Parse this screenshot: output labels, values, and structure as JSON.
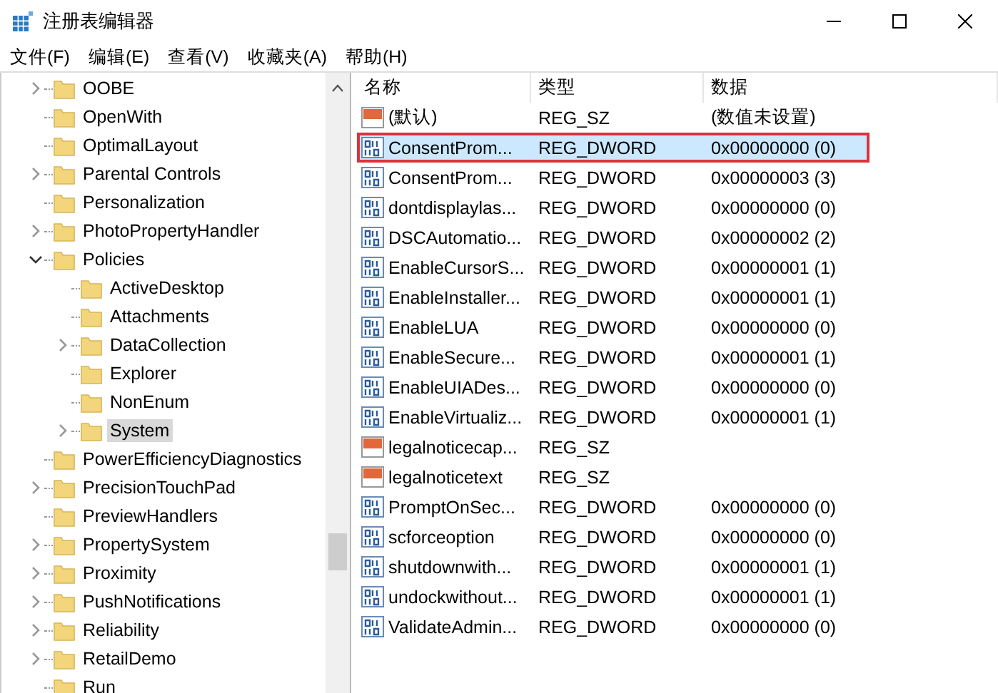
{
  "window": {
    "title": "注册表编辑器"
  },
  "menu": [
    "文件(F)",
    "编辑(E)",
    "查看(V)",
    "收藏夹(A)",
    "帮助(H)"
  ],
  "tree": [
    {
      "kind": "branch",
      "label": "OOBE",
      "expanded": false,
      "selected": false
    },
    {
      "kind": "leaf",
      "label": "OpenWith",
      "selected": false
    },
    {
      "kind": "leaf",
      "label": "OptimalLayout",
      "selected": false
    },
    {
      "kind": "branch",
      "label": "Parental Controls",
      "expanded": false,
      "selected": false
    },
    {
      "kind": "leaf",
      "label": "Personalization",
      "selected": false
    },
    {
      "kind": "branch",
      "label": "PhotoPropertyHandler",
      "expanded": false,
      "selected": false
    },
    {
      "kind": "branch",
      "label": "Policies",
      "expanded": true,
      "selected": false,
      "children": [
        {
          "kind": "leaf",
          "label": "ActiveDesktop",
          "selected": false
        },
        {
          "kind": "leaf",
          "label": "Attachments",
          "selected": false
        },
        {
          "kind": "branch",
          "label": "DataCollection",
          "expanded": false,
          "selected": false
        },
        {
          "kind": "leaf",
          "label": "Explorer",
          "selected": false
        },
        {
          "kind": "leaf",
          "label": "NonEnum",
          "selected": false
        },
        {
          "kind": "branch",
          "label": "System",
          "expanded": false,
          "selected": true
        }
      ]
    },
    {
      "kind": "leaf",
      "label": "PowerEfficiencyDiagnostics",
      "selected": false
    },
    {
      "kind": "branch",
      "label": "PrecisionTouchPad",
      "expanded": false,
      "selected": false
    },
    {
      "kind": "leaf",
      "label": "PreviewHandlers",
      "selected": false
    },
    {
      "kind": "branch",
      "label": "PropertySystem",
      "expanded": false,
      "selected": false
    },
    {
      "kind": "branch",
      "label": "Proximity",
      "expanded": false,
      "selected": false
    },
    {
      "kind": "branch",
      "label": "PushNotifications",
      "expanded": false,
      "selected": false
    },
    {
      "kind": "branch",
      "label": "Reliability",
      "expanded": false,
      "selected": false
    },
    {
      "kind": "branch",
      "label": "RetailDemo",
      "expanded": false,
      "selected": false
    },
    {
      "kind": "leaf",
      "label": "Run",
      "selected": false
    }
  ],
  "table": {
    "columns": [
      "名称",
      "类型",
      "数据"
    ],
    "rows": [
      {
        "kind": "sz",
        "name": "(默认)",
        "type": "REG_SZ",
        "data": "(数值未设置)",
        "selected": false,
        "outlined": false
      },
      {
        "kind": "dword",
        "name": "ConsentProm...",
        "type": "REG_DWORD",
        "data": "0x00000000 (0)",
        "selected": true,
        "outlined": true
      },
      {
        "kind": "dword",
        "name": "ConsentProm...",
        "type": "REG_DWORD",
        "data": "0x00000003 (3)",
        "selected": false,
        "outlined": false
      },
      {
        "kind": "dword",
        "name": "dontdisplaylas...",
        "type": "REG_DWORD",
        "data": "0x00000000 (0)",
        "selected": false,
        "outlined": false
      },
      {
        "kind": "dword",
        "name": "DSCAutomatio...",
        "type": "REG_DWORD",
        "data": "0x00000002 (2)",
        "selected": false,
        "outlined": false
      },
      {
        "kind": "dword",
        "name": "EnableCursorS...",
        "type": "REG_DWORD",
        "data": "0x00000001 (1)",
        "selected": false,
        "outlined": false
      },
      {
        "kind": "dword",
        "name": "EnableInstaller...",
        "type": "REG_DWORD",
        "data": "0x00000001 (1)",
        "selected": false,
        "outlined": false
      },
      {
        "kind": "dword",
        "name": "EnableLUA",
        "type": "REG_DWORD",
        "data": "0x00000000 (0)",
        "selected": false,
        "outlined": false
      },
      {
        "kind": "dword",
        "name": "EnableSecure...",
        "type": "REG_DWORD",
        "data": "0x00000001 (1)",
        "selected": false,
        "outlined": false
      },
      {
        "kind": "dword",
        "name": "EnableUIADes...",
        "type": "REG_DWORD",
        "data": "0x00000000 (0)",
        "selected": false,
        "outlined": false
      },
      {
        "kind": "dword",
        "name": "EnableVirtualiz...",
        "type": "REG_DWORD",
        "data": "0x00000001 (1)",
        "selected": false,
        "outlined": false
      },
      {
        "kind": "sz",
        "name": "legalnoticecap...",
        "type": "REG_SZ",
        "selected": false,
        "outlined": false
      },
      {
        "kind": "sz",
        "name": "legalnoticetext",
        "type": "REG_SZ",
        "selected": false,
        "outlined": false
      },
      {
        "kind": "dword",
        "name": "PromptOnSec...",
        "type": "REG_DWORD",
        "data": "0x00000000 (0)",
        "selected": false,
        "outlined": false
      },
      {
        "kind": "dword",
        "name": "scforceoption",
        "type": "REG_DWORD",
        "data": "0x00000000 (0)",
        "selected": false,
        "outlined": false
      },
      {
        "kind": "dword",
        "name": "shutdownwith...",
        "type": "REG_DWORD",
        "data": "0x00000001 (1)",
        "selected": false,
        "outlined": false
      },
      {
        "kind": "dword",
        "name": "undockwithout...",
        "type": "REG_DWORD",
        "data": "0x00000001 (1)",
        "selected": false,
        "outlined": false
      },
      {
        "kind": "dword",
        "name": "ValidateAdmin...",
        "type": "REG_DWORD",
        "data": "0x00000000 (0)",
        "selected": false,
        "outlined": false
      }
    ]
  }
}
